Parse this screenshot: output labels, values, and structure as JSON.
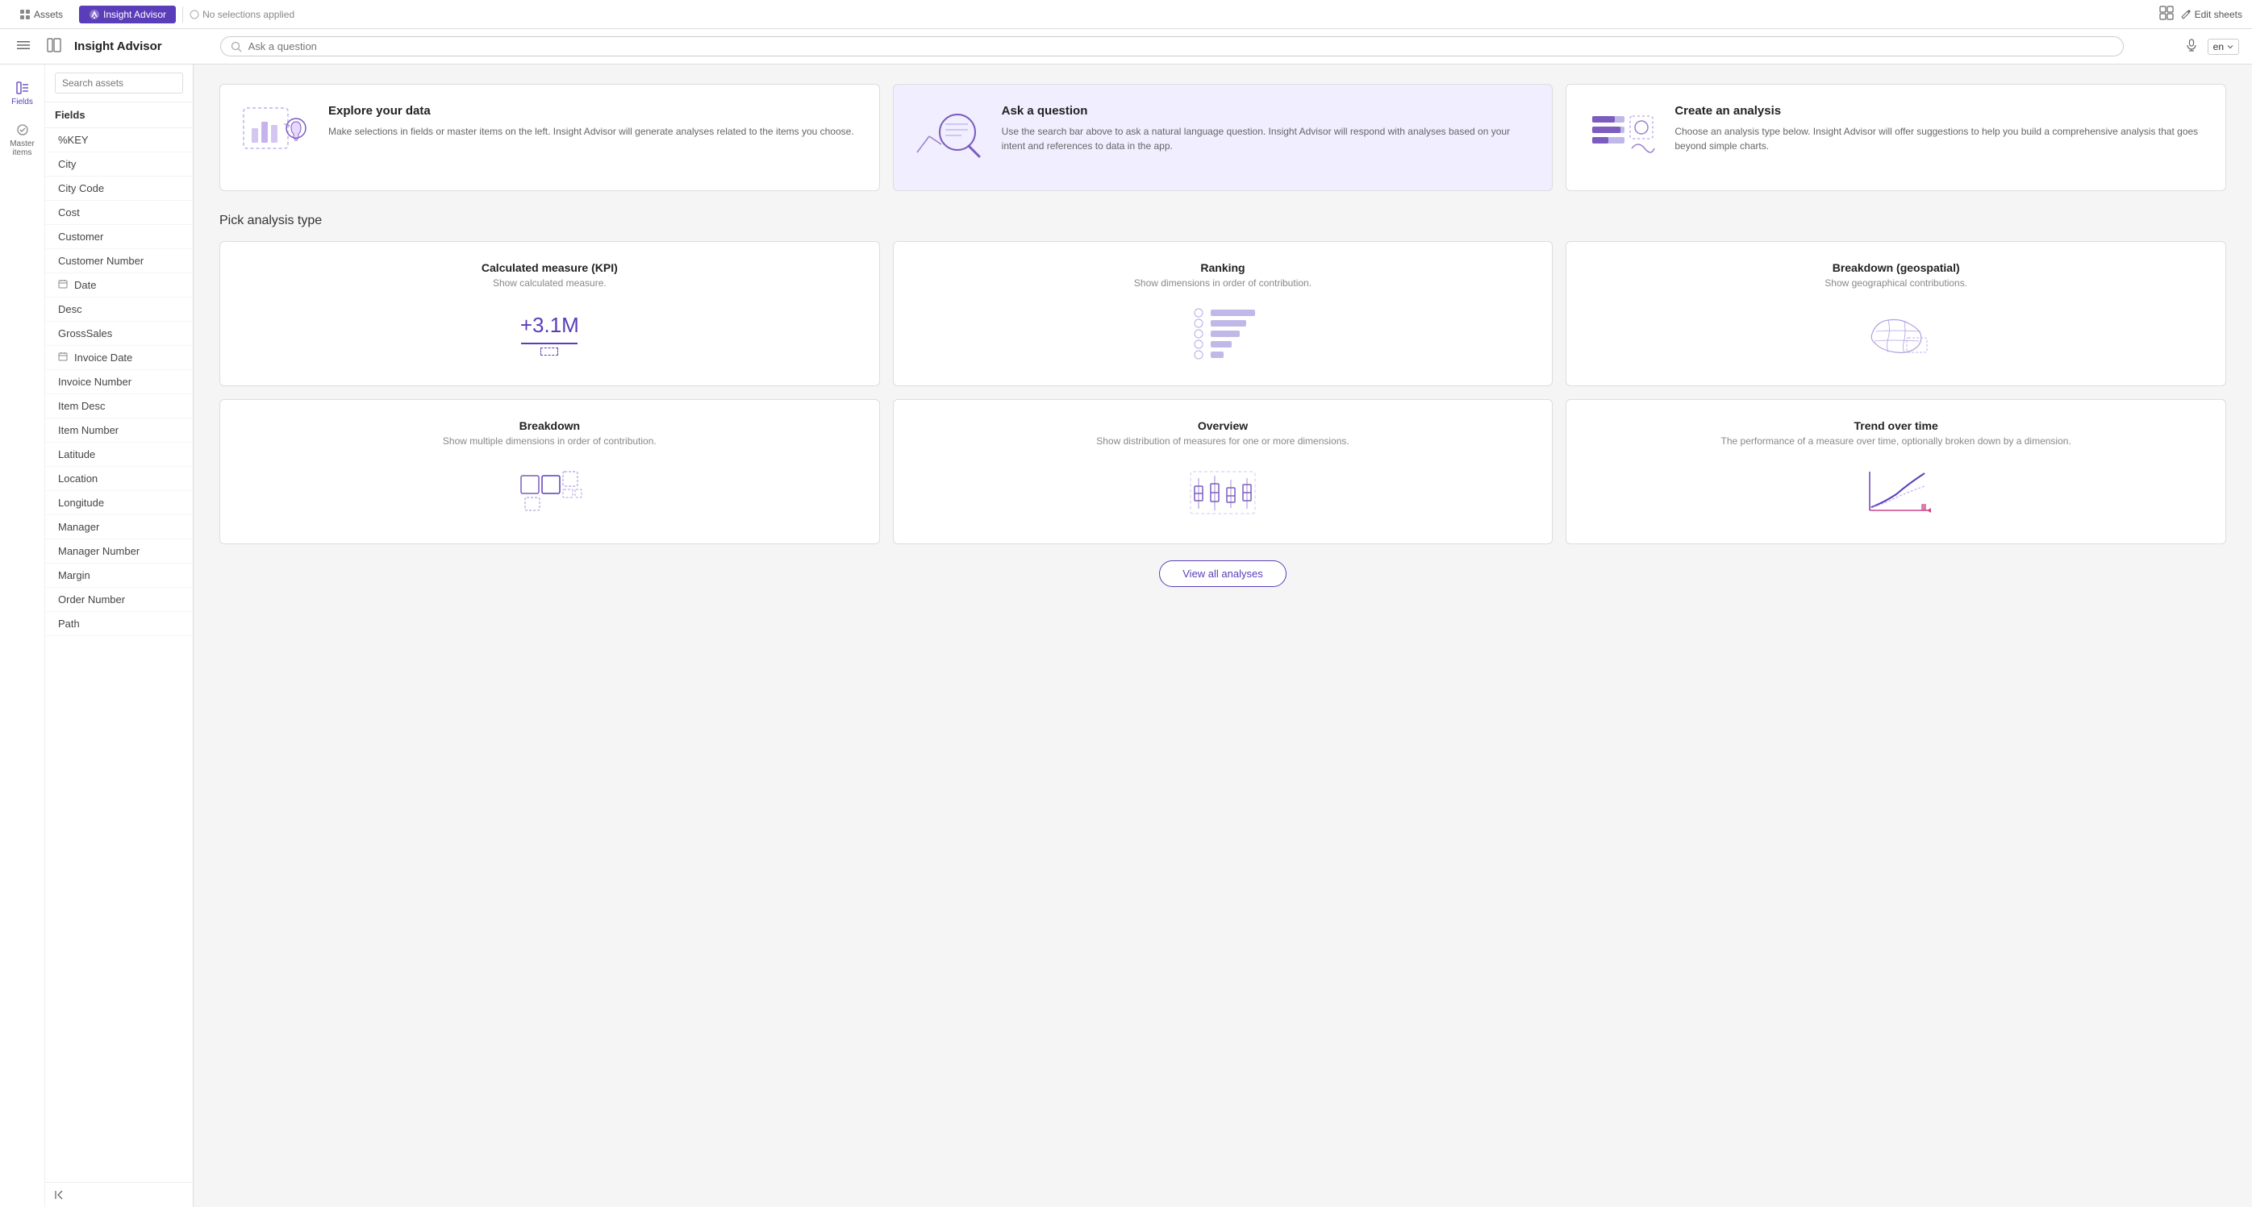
{
  "topNav": {
    "items": [
      {
        "id": "assets",
        "label": "Assets",
        "active": false
      },
      {
        "id": "insight-advisor",
        "label": "Insight Advisor",
        "active": true
      }
    ],
    "noSelections": "No selections applied",
    "editSheets": "Edit sheets"
  },
  "toolbar": {
    "title": "Insight Advisor",
    "searchPlaceholder": "Ask a question",
    "language": "en"
  },
  "sidebar": {
    "searchPlaceholder": "Search assets",
    "fieldsLabel": "Fields",
    "masterItemsLabel": "Master items",
    "items": [
      {
        "id": "key",
        "label": "%KEY",
        "icon": ""
      },
      {
        "id": "city",
        "label": "City",
        "icon": ""
      },
      {
        "id": "city-code",
        "label": "City Code",
        "icon": ""
      },
      {
        "id": "cost",
        "label": "Cost",
        "icon": ""
      },
      {
        "id": "customer",
        "label": "Customer",
        "icon": ""
      },
      {
        "id": "customer-number",
        "label": "Customer Number",
        "icon": ""
      },
      {
        "id": "date",
        "label": "Date",
        "icon": "calendar"
      },
      {
        "id": "desc",
        "label": "Desc",
        "icon": ""
      },
      {
        "id": "gross-sales",
        "label": "GrossSales",
        "icon": ""
      },
      {
        "id": "invoice-date",
        "label": "Invoice Date",
        "icon": "calendar"
      },
      {
        "id": "invoice-number",
        "label": "Invoice Number",
        "icon": ""
      },
      {
        "id": "item-desc",
        "label": "Item Desc",
        "icon": ""
      },
      {
        "id": "item-number",
        "label": "Item Number",
        "icon": ""
      },
      {
        "id": "latitude",
        "label": "Latitude",
        "icon": ""
      },
      {
        "id": "location",
        "label": "Location",
        "icon": ""
      },
      {
        "id": "longitude",
        "label": "Longitude",
        "icon": ""
      },
      {
        "id": "manager",
        "label": "Manager",
        "icon": ""
      },
      {
        "id": "manager-number",
        "label": "Manager Number",
        "icon": ""
      },
      {
        "id": "margin",
        "label": "Margin",
        "icon": ""
      },
      {
        "id": "order-number",
        "label": "Order Number",
        "icon": ""
      },
      {
        "id": "path",
        "label": "Path",
        "icon": ""
      }
    ]
  },
  "introCards": [
    {
      "id": "explore",
      "title": "Explore your data",
      "description": "Make selections in fields or master items on the left. Insight Advisor will generate analyses related to the items you choose."
    },
    {
      "id": "ask",
      "title": "Ask a question",
      "description": "Use the search bar above to ask a natural language question. Insight Advisor will respond with analyses based on your intent and references to data in the app."
    },
    {
      "id": "create",
      "title": "Create an analysis",
      "description": "Choose an analysis type below. Insight Advisor will offer suggestions to help you build a comprehensive analysis that goes beyond simple charts."
    }
  ],
  "pickAnalysis": {
    "sectionTitle": "Pick analysis type",
    "analyses": [
      {
        "id": "kpi",
        "title": "Calculated measure (KPI)",
        "description": "Show calculated measure.",
        "kpiValue": "+3.1M"
      },
      {
        "id": "ranking",
        "title": "Ranking",
        "description": "Show dimensions in order of contribution."
      },
      {
        "id": "geo",
        "title": "Breakdown (geospatial)",
        "description": "Show geographical contributions."
      },
      {
        "id": "breakdown",
        "title": "Breakdown",
        "description": "Show multiple dimensions in order of contribution."
      },
      {
        "id": "overview",
        "title": "Overview",
        "description": "Show distribution of measures for one or more dimensions."
      },
      {
        "id": "trend",
        "title": "Trend over time",
        "description": "The performance of a measure over time, optionally broken down by a dimension."
      }
    ],
    "viewAllLabel": "View all analyses"
  }
}
